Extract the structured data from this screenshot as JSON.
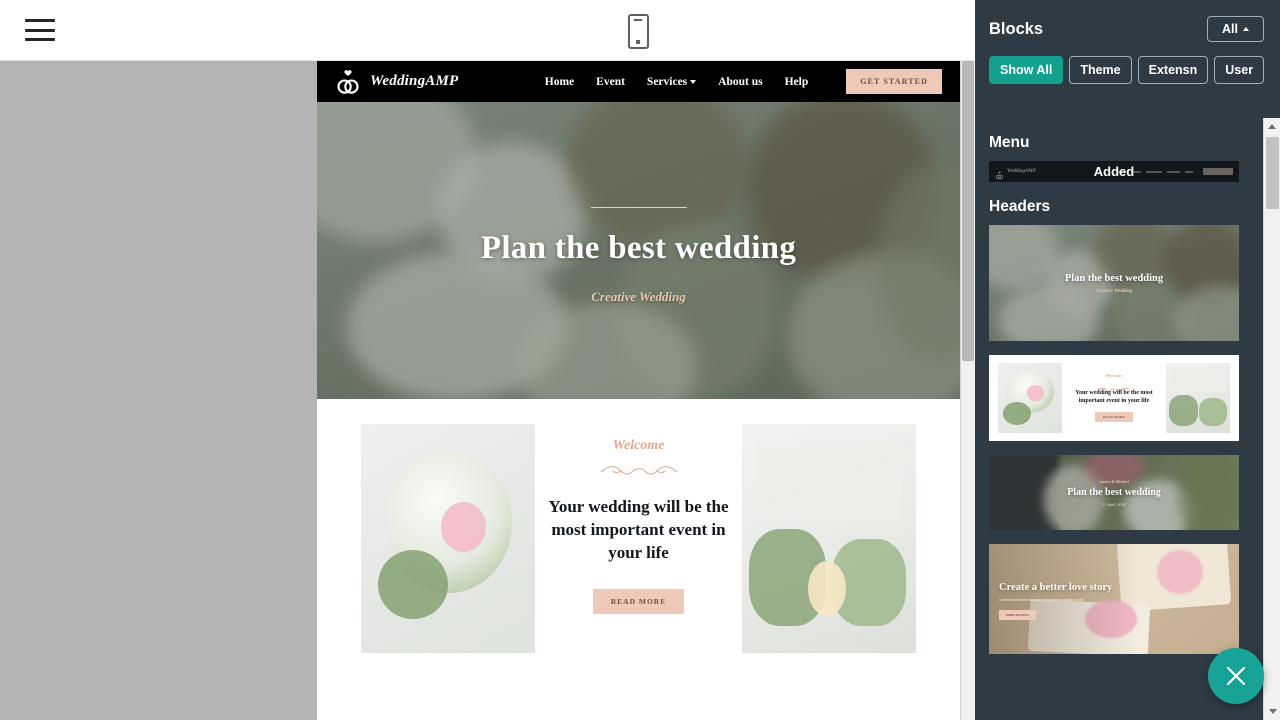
{
  "toolbar": {
    "menu_icon": "hamburger-icon",
    "preview_icon": "mobile-preview-icon"
  },
  "site": {
    "brand": "WeddingAMP",
    "logo_icon": "wedding-rings-heart-icon",
    "nav": [
      {
        "label": "Home",
        "has_caret": false
      },
      {
        "label": "Event",
        "has_caret": false
      },
      {
        "label": "Services",
        "has_caret": true
      },
      {
        "label": "About us",
        "has_caret": false
      },
      {
        "label": "Help",
        "has_caret": false
      }
    ],
    "cta": "GET STARTED",
    "hero": {
      "title": "Plan the best wedding",
      "subtitle": "Creative Wedding"
    },
    "welcome": {
      "kicker": "Welcome",
      "heading": "Your wedding will be the most important event in your life",
      "button": "READ MORE"
    }
  },
  "panel": {
    "title": "Blocks",
    "all_button": "All",
    "filters": [
      {
        "label": "Show All",
        "active": true
      },
      {
        "label": "Theme",
        "active": false
      },
      {
        "label": "Extensn",
        "active": false
      },
      {
        "label": "User",
        "active": false
      }
    ],
    "groups": [
      {
        "title": "Menu",
        "items": [
          {
            "type": "menu",
            "badge": "Added",
            "brand": "WeddingAMP",
            "cta": "GET STARTED"
          }
        ]
      },
      {
        "title": "Headers",
        "items": [
          {
            "type": "hero",
            "title": "Plan the best wedding",
            "subtitle": "Creative Wedding"
          },
          {
            "type": "welcome",
            "kicker": "Welcome",
            "heading": "Your wedding will be the most important event in your life",
            "button": "READ MORE"
          },
          {
            "type": "hands",
            "pretitle": "Jessica & Michael",
            "title": "Plan the best wedding",
            "subtitle": "11 April, 2018"
          },
          {
            "type": "gifts",
            "title": "Create a better love story",
            "description": "Lorem ipsum dolor sit amet, consectetur adipisicing elit",
            "button": "MORE DETAILS"
          }
        ]
      }
    ],
    "close_fab_icon": "close-icon",
    "accent_color": "#17a398",
    "panel_bg": "#2f3b44"
  }
}
